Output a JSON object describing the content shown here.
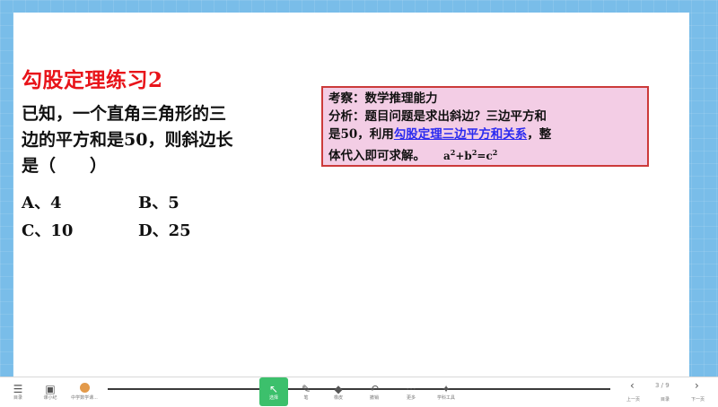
{
  "slide": {
    "title": "勾股定理练习2",
    "question_lines": [
      "已知，一个直角三角形的三",
      "边的平方和是50，则斜边长",
      "是（　　）"
    ],
    "options": [
      {
        "label": "A、4"
      },
      {
        "label": "B、5"
      },
      {
        "label": "C、10"
      },
      {
        "label": "D、25"
      }
    ],
    "note": {
      "line1": "考察：数学推理能力",
      "line2": "分析：题目问题是求出斜边？三边平方和",
      "line3_pre": "是50，利用",
      "line3_link": "勾股定理三边平方和关系",
      "line3_post": "，整",
      "line4": "体代入即可求解。",
      "formula_a": "a",
      "formula_b": "+b",
      "formula_c": "=c",
      "exp": "2"
    }
  },
  "toolbar": {
    "left_items": [
      {
        "icon": "☰",
        "label": "目录"
      },
      {
        "icon": "▣",
        "label": "课小纪"
      },
      {
        "icon": "●",
        "label": "中学数学课..."
      }
    ],
    "select": {
      "icon": "↖",
      "label": "选择"
    },
    "tools": [
      {
        "icon": "✎",
        "label": "笔"
      },
      {
        "icon": "◆",
        "label": "橡皮"
      },
      {
        "icon": "↶",
        "label": "撤销"
      },
      {
        "icon": "···",
        "label": "更多"
      },
      {
        "icon": "✦",
        "label": "学科工具"
      }
    ],
    "pager": {
      "prev_label": "上一页",
      "page_text": "3 / 9",
      "menu_label": "目录",
      "next_label": "下一页"
    }
  }
}
